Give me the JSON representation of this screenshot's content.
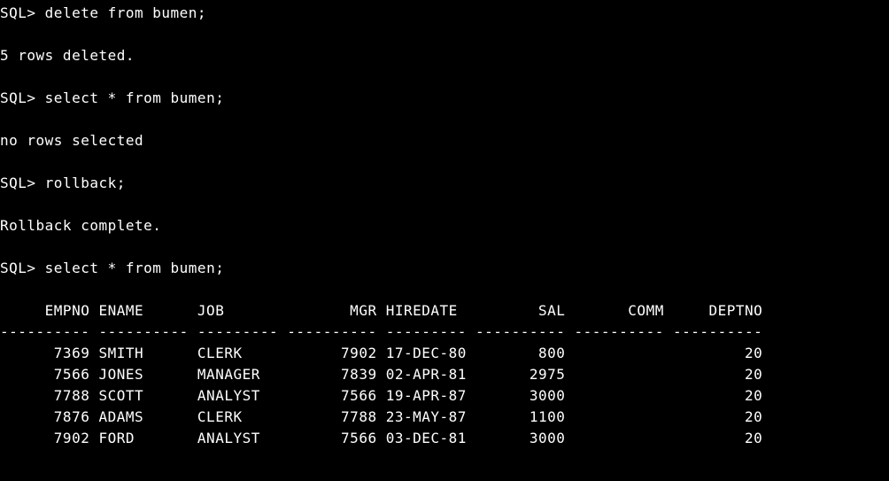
{
  "terminal": {
    "prompt": "SQL>",
    "lines": {
      "cmd1": "delete from bumen;",
      "resp1": "5 rows deleted.",
      "cmd2": "select * from bumen;",
      "resp2": "no rows selected",
      "cmd3": "rollback;",
      "resp3": "Rollback complete.",
      "cmd4": "select * from bumen;"
    },
    "table": {
      "header": "     EMPNO ENAME      JOB              MGR HIREDATE         SAL       COMM     DEPTNO",
      "divider": "---------- ---------- --------- ---------- --------- ---------- ---------- ----------",
      "rows": [
        "      7369 SMITH      CLERK           7902 17-DEC-80        800                    20",
        "      7566 JONES      MANAGER         7839 02-APR-81       2975                    20",
        "      7788 SCOTT      ANALYST         7566 19-APR-87       3000                    20",
        "      7876 ADAMS      CLERK           7788 23-MAY-87       1100                    20",
        "      7902 FORD       ANALYST         7566 03-DEC-81       3000                    20"
      ]
    }
  },
  "chart_data": {
    "type": "table",
    "columns": [
      "EMPNO",
      "ENAME",
      "JOB",
      "MGR",
      "HIREDATE",
      "SAL",
      "COMM",
      "DEPTNO"
    ],
    "rows": [
      {
        "EMPNO": 7369,
        "ENAME": "SMITH",
        "JOB": "CLERK",
        "MGR": 7902,
        "HIREDATE": "17-DEC-80",
        "SAL": 800,
        "COMM": null,
        "DEPTNO": 20
      },
      {
        "EMPNO": 7566,
        "ENAME": "JONES",
        "JOB": "MANAGER",
        "MGR": 7839,
        "HIREDATE": "02-APR-81",
        "SAL": 2975,
        "COMM": null,
        "DEPTNO": 20
      },
      {
        "EMPNO": 7788,
        "ENAME": "SCOTT",
        "JOB": "ANALYST",
        "MGR": 7566,
        "HIREDATE": "19-APR-87",
        "SAL": 3000,
        "COMM": null,
        "DEPTNO": 20
      },
      {
        "EMPNO": 7876,
        "ENAME": "ADAMS",
        "JOB": "CLERK",
        "MGR": 7788,
        "HIREDATE": "23-MAY-87",
        "SAL": 1100,
        "COMM": null,
        "DEPTNO": 20
      },
      {
        "EMPNO": 7902,
        "ENAME": "FORD",
        "JOB": "ANALYST",
        "MGR": 7566,
        "HIREDATE": "03-DEC-81",
        "SAL": 3000,
        "COMM": null,
        "DEPTNO": 20
      }
    ]
  }
}
